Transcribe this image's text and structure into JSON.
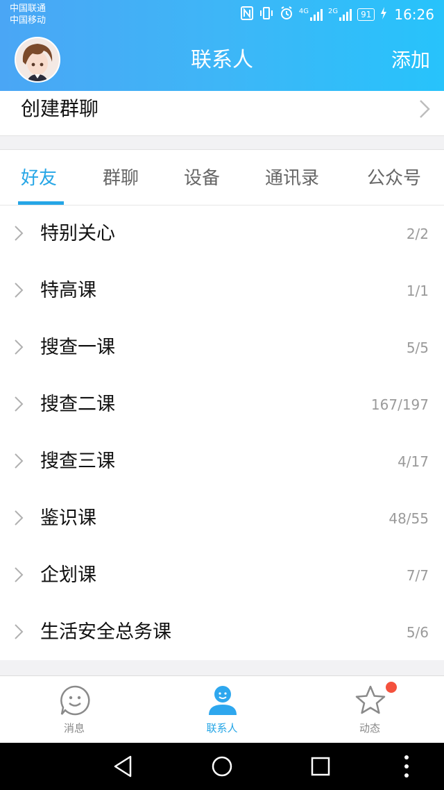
{
  "statusbar": {
    "carrier1": "中国联通",
    "carrier2": "中国移动",
    "net1": "4G",
    "net2": "2G",
    "battery": "91",
    "time": "16:26"
  },
  "header": {
    "title": "联系人",
    "add_label": "添加"
  },
  "create_group": {
    "label": "创建群聊"
  },
  "tabs": [
    {
      "label": "好友",
      "active": true
    },
    {
      "label": "群聊",
      "active": false
    },
    {
      "label": "设备",
      "active": false
    },
    {
      "label": "通讯录",
      "active": false
    },
    {
      "label": "公众号",
      "active": false
    }
  ],
  "groups": [
    {
      "name": "特别关心",
      "count": "2/2"
    },
    {
      "name": "特高课",
      "count": "1/1"
    },
    {
      "name": "搜查一课",
      "count": "5/5"
    },
    {
      "name": "搜查二课",
      "count": "167/197"
    },
    {
      "name": "搜查三课",
      "count": "4/17"
    },
    {
      "name": "鉴识课",
      "count": "48/55"
    },
    {
      "name": "企划课",
      "count": "7/7"
    },
    {
      "name": "生活安全总务课",
      "count": "5/6"
    }
  ],
  "bottom_tabs": [
    {
      "label": "消息",
      "icon": "message-smiley-icon"
    },
    {
      "label": "联系人",
      "icon": "contacts-person-icon",
      "active": true
    },
    {
      "label": "动态",
      "icon": "star-icon",
      "badge": true
    }
  ],
  "colors": {
    "accent": "#26a6e6",
    "header_start": "#4aa6f5",
    "header_end": "#27c3fb",
    "badge": "#f4513d"
  }
}
